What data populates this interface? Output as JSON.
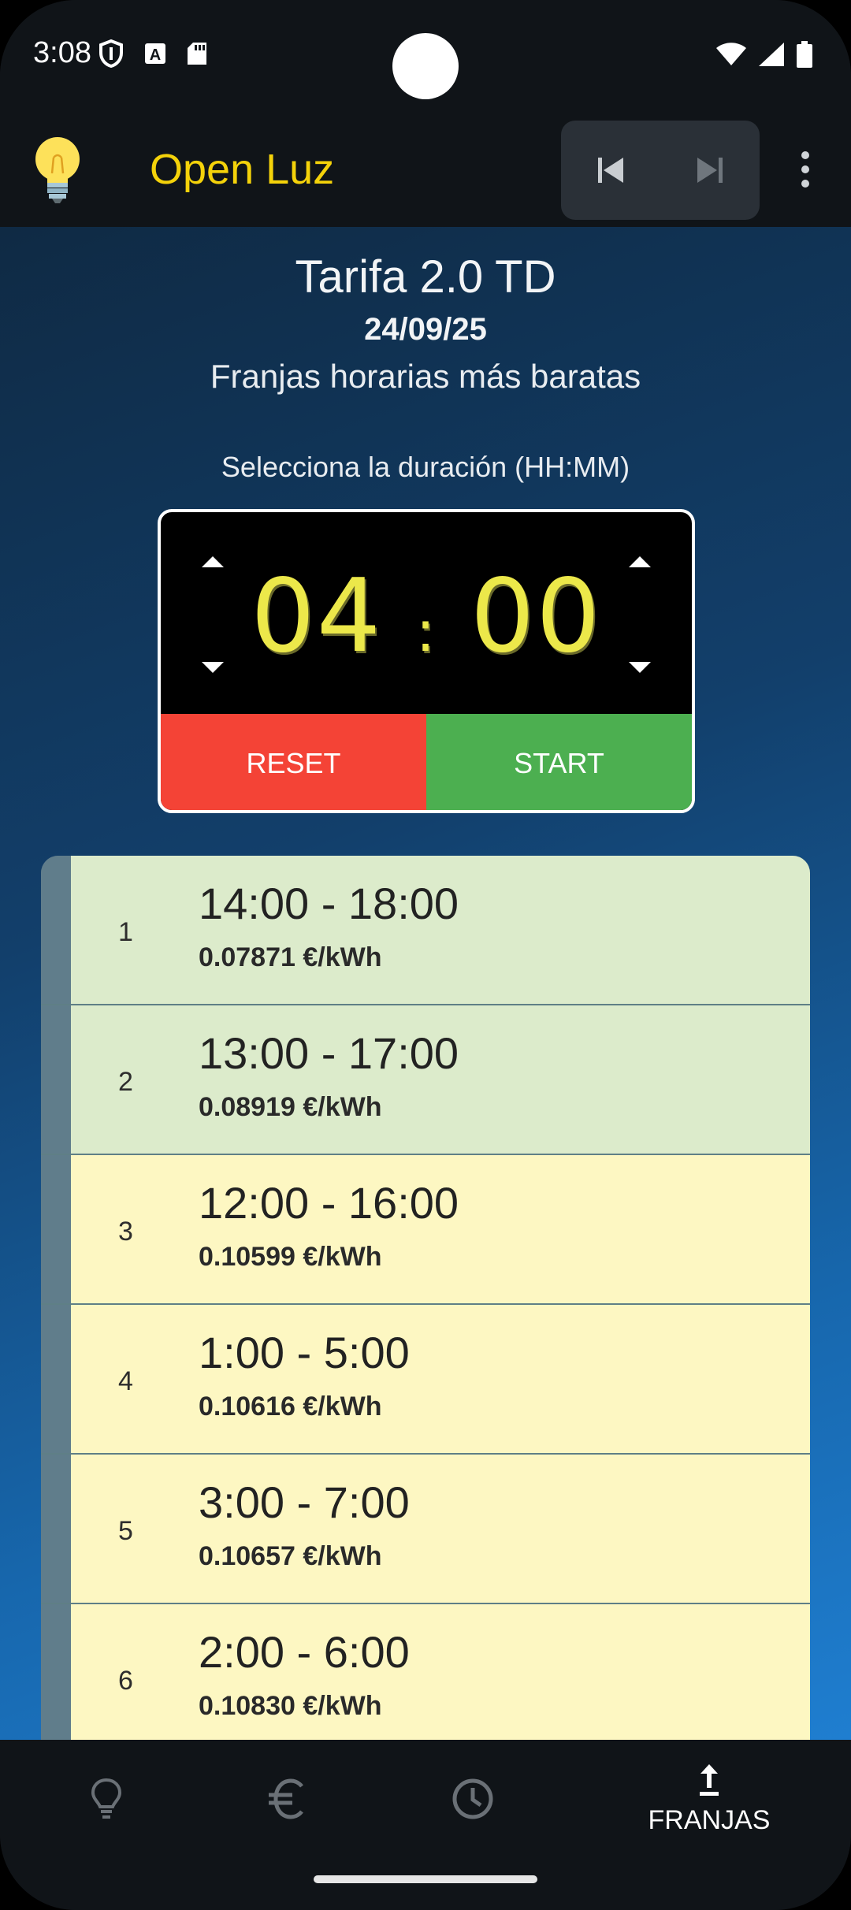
{
  "status_bar": {
    "time": "3:08"
  },
  "app_bar": {
    "title": "Open Luz"
  },
  "header": {
    "tariff": "Tarifa 2.0 TD",
    "date": "24/09/25",
    "subtitle": "Franjas horarias más baratas"
  },
  "timer": {
    "label": "Selecciona la duración (HH:MM)",
    "hours": "04",
    "separator": ":",
    "minutes": "00",
    "reset_label": "RESET",
    "start_label": "START"
  },
  "slots": [
    {
      "rank": "1",
      "range": "14:00 - 18:00",
      "price": "0.07871 €/kWh",
      "color": "#dcebcb"
    },
    {
      "rank": "2",
      "range": "13:00 - 17:00",
      "price": "0.08919 €/kWh",
      "color": "#dcebcb"
    },
    {
      "rank": "3",
      "range": "12:00 - 16:00",
      "price": "0.10599 €/kWh",
      "color": "#fdf7c2"
    },
    {
      "rank": "4",
      "range": "1:00 - 5:00",
      "price": "0.10616 €/kWh",
      "color": "#fdf7c2"
    },
    {
      "rank": "5",
      "range": "3:00 - 7:00",
      "price": "0.10657 €/kWh",
      "color": "#fdf7c2"
    },
    {
      "rank": "6",
      "range": "2:00 - 6:00",
      "price": "0.10830 €/kWh",
      "color": "#fdf7c2"
    }
  ],
  "bottom_nav": {
    "active_label": "FRANJAS",
    "items": [
      "lightbulb-icon",
      "euro-icon",
      "clock-icon",
      "upload-icon"
    ]
  },
  "colors": {
    "brand_title": "#f4d20a",
    "reset": "#f44336",
    "start": "#4caf50",
    "timer_digits": "#ece84a"
  }
}
